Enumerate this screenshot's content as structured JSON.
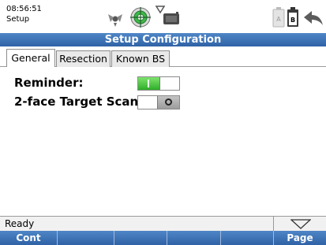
{
  "status": {
    "time": "08:56:51",
    "mode": "Setup"
  },
  "title": "Setup Configuration",
  "tabs": [
    {
      "label": "General",
      "active": true
    },
    {
      "label": "Resection",
      "active": false
    },
    {
      "label": "Known BS",
      "active": false
    }
  ],
  "settings": [
    {
      "label": "Reminder:",
      "state": "on"
    },
    {
      "label": "2-face Target Scan:",
      "state": "off"
    }
  ],
  "statusline": {
    "text": "Ready"
  },
  "softkeys": [
    "Cont",
    "",
    "",
    "",
    "",
    "Page"
  ],
  "colors": {
    "bar_blue": "#3b72b8",
    "toggle_on": "#3fbf35",
    "toggle_off": "#a8a8a8"
  },
  "icons": [
    "satellite-icon",
    "target-prism-icon",
    "signal-icon",
    "battery-a-icon",
    "battery-b-icon",
    "back-arrow-icon",
    "chevron-down-icon"
  ]
}
